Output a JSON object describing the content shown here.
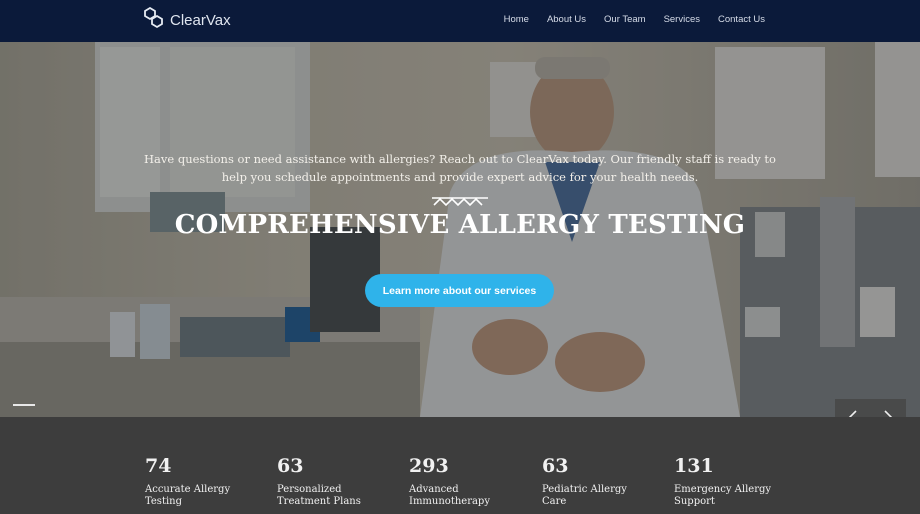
{
  "brand": {
    "name": "ClearVax",
    "logo_icon": "hexagon-molecule-icon"
  },
  "nav": {
    "items": [
      {
        "label": "Home"
      },
      {
        "label": "About Us"
      },
      {
        "label": "Our Team"
      },
      {
        "label": "Services"
      },
      {
        "label": "Contact Us"
      }
    ]
  },
  "hero": {
    "tagline": "Have questions or need assistance with allergies? Reach out to ClearVax today. Our friendly staff is ready to help you schedule appointments and provide expert advice for your health needs.",
    "title": "COMPREHENSIVE ALLERGY TESTING",
    "cta_label": "Learn more about our services",
    "prev_icon": "chevron-left-icon",
    "next_icon": "chevron-right-icon"
  },
  "stats": [
    {
      "value": "74",
      "label": "Accurate Allergy\nTesting"
    },
    {
      "value": "63",
      "label": "Personalized\nTreatment Plans"
    },
    {
      "value": "293",
      "label": "Advanced\nImmunotherapy"
    },
    {
      "value": "63",
      "label": "Pediatric Allergy\nCare"
    },
    {
      "value": "131",
      "label": "Emergency Allergy\nSupport"
    }
  ],
  "colors": {
    "navbar": "#0b1a3a",
    "accent": "#2fb3ea",
    "stats_bg": "#3d3d3d"
  }
}
